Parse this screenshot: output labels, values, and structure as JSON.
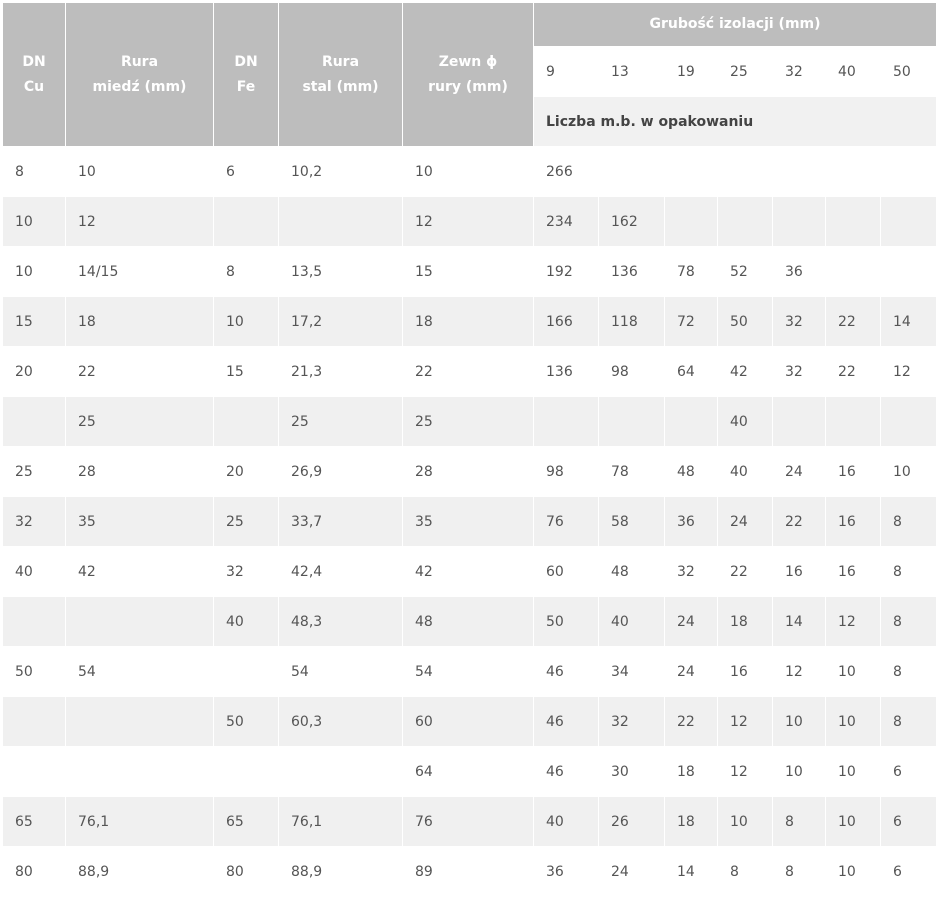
{
  "table": {
    "headers": {
      "dn_cu_line1": "DN",
      "dn_cu_line2": "Cu",
      "rura_miedz_line1": "Rura",
      "rura_miedz_line2": "miedź (mm)",
      "dn_fe_line1": "DN",
      "dn_fe_line2": "Fe",
      "rura_stal_line1": "Rura",
      "rura_stal_line2": "stal (mm)",
      "zewn_line1": "Zewn ϕ",
      "zewn_line2": "rury (mm)",
      "grubosc": "Grubość izolacji (mm)",
      "thickness": [
        "9",
        "13",
        "19",
        "25",
        "32",
        "40",
        "50"
      ],
      "liczba": "Liczba m.b. w opakowaniu"
    },
    "rows": [
      [
        "8",
        "10",
        "6",
        "10,2",
        "10",
        "266",
        "",
        "",
        "",
        "",
        "",
        ""
      ],
      [
        "10",
        "12",
        "",
        "",
        "12",
        "234",
        "162",
        "",
        "",
        "",
        "",
        ""
      ],
      [
        "10",
        "14/15",
        "8",
        "13,5",
        "15",
        "192",
        "136",
        "78",
        "52",
        "36",
        "",
        ""
      ],
      [
        "15",
        "18",
        "10",
        "17,2",
        "18",
        "166",
        "118",
        "72",
        "50",
        "32",
        "22",
        "14"
      ],
      [
        "20",
        "22",
        "15",
        "21,3",
        "22",
        "136",
        "98",
        "64",
        "42",
        "32",
        "22",
        "12"
      ],
      [
        "",
        "25",
        "",
        "25",
        "25",
        "",
        "",
        "",
        "40",
        "",
        "",
        ""
      ],
      [
        "25",
        "28",
        "20",
        "26,9",
        "28",
        "98",
        "78",
        "48",
        "40",
        "24",
        "16",
        "10"
      ],
      [
        "32",
        "35",
        "25",
        "33,7",
        "35",
        "76",
        "58",
        "36",
        "24",
        "22",
        "16",
        "8"
      ],
      [
        "40",
        "42",
        "32",
        "42,4",
        "42",
        "60",
        "48",
        "32",
        "22",
        "16",
        "16",
        "8"
      ],
      [
        "",
        "",
        "40",
        "48,3",
        "48",
        "50",
        "40",
        "24",
        "18",
        "14",
        "12",
        "8"
      ],
      [
        "50",
        "54",
        "",
        "54",
        "54",
        "46",
        "34",
        "24",
        "16",
        "12",
        "10",
        "8"
      ],
      [
        "",
        "",
        "50",
        "60,3",
        "60",
        "46",
        "32",
        "22",
        "12",
        "10",
        "10",
        "8"
      ],
      [
        "",
        "",
        "",
        "",
        "64",
        "46",
        "30",
        "18",
        "12",
        "10",
        "10",
        "6"
      ],
      [
        "65",
        "76,1",
        "65",
        "76,1",
        "76",
        "40",
        "26",
        "18",
        "10",
        "8",
        "10",
        "6"
      ],
      [
        "80",
        "88,9",
        "80",
        "88,9",
        "89",
        "36",
        "24",
        "14",
        "8",
        "8",
        "10",
        "6"
      ]
    ]
  }
}
